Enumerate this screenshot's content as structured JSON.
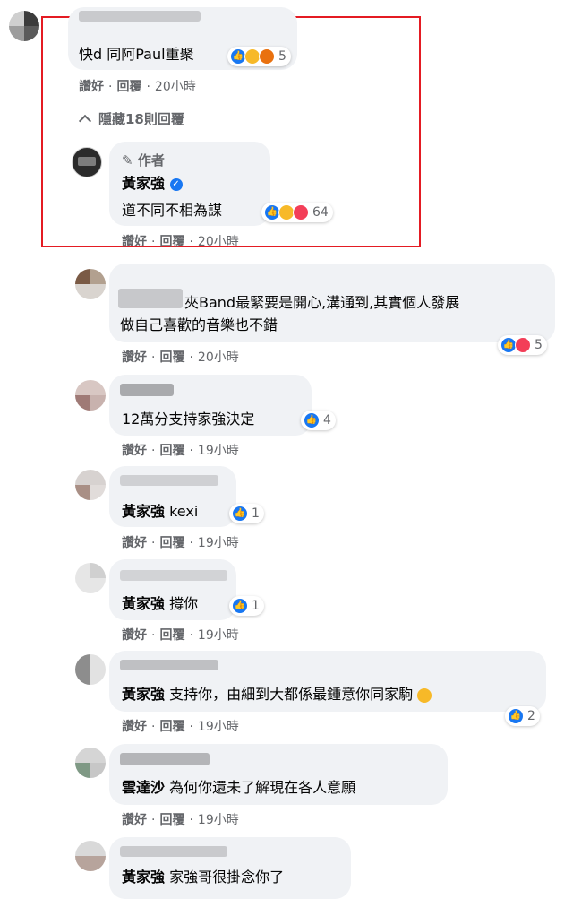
{
  "comments": [
    {
      "text": "快d 同阿Paul重聚",
      "reaction_count": "5",
      "like_label": "讚好",
      "reply_label": "回覆",
      "time": "20小時"
    },
    {
      "text": "夾Band最緊要是開心,溝通到,其實個人發展",
      "text2": "做自己喜歡的音樂也不錯",
      "reaction_count": "5",
      "like_label": "讚好",
      "reply_label": "回覆",
      "time": "20小時"
    },
    {
      "text": "12萬分支持家強決定",
      "reaction_count": "4",
      "like_label": "讚好",
      "reply_label": "回覆",
      "time": "19小時"
    },
    {
      "mention": "黃家強",
      "text": "kexi",
      "reaction_count": "1",
      "like_label": "讚好",
      "reply_label": "回覆",
      "time": "19小時"
    },
    {
      "mention": "黃家強",
      "text": "撐你",
      "reaction_count": "1",
      "like_label": "讚好",
      "reply_label": "回覆",
      "time": "19小時"
    },
    {
      "mention": "黃家強",
      "text": "支持你，由細到大都係最鍾意你同家駒",
      "reaction_count": "2",
      "like_label": "讚好",
      "reply_label": "回覆",
      "time": "19小時"
    },
    {
      "mention": "雲達沙",
      "text": "為何你還未了解現在各人意願",
      "like_label": "讚好",
      "reply_label": "回覆",
      "time": "19小時"
    },
    {
      "mention": "黃家強",
      "text": "家強哥很掛念你了"
    }
  ],
  "hide_replies": "隱藏18則回覆",
  "author_reply": {
    "badge": "作者",
    "name": "黃家強",
    "text": "道不同不相為謀",
    "reaction_count": "64",
    "like_label": "讚好",
    "reply_label": "回覆",
    "time": "20小時"
  },
  "colors": {
    "accent": "#1877f2",
    "highlight_box": "#e41b23",
    "bubble": "#f0f2f5",
    "meta_text": "#65676b"
  }
}
